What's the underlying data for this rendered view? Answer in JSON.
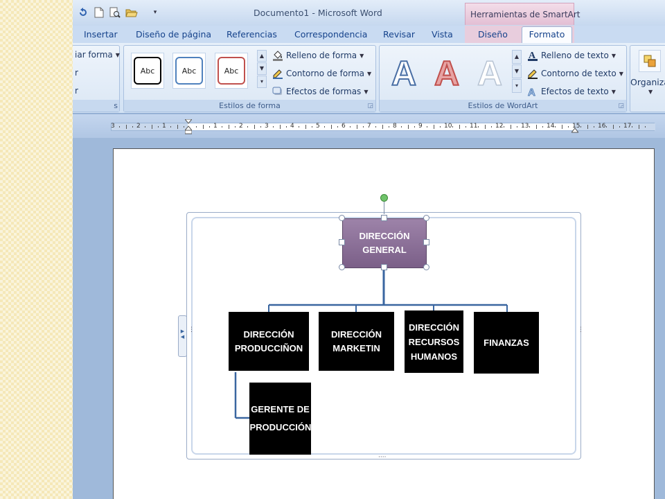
{
  "window": {
    "title": "Documento1 - Microsoft Word"
  },
  "contextual_tab_group": "Herramientas de SmartArt",
  "tabs": [
    "Insertar",
    "Diseño de página",
    "Referencias",
    "Correspondencia",
    "Revisar",
    "Vista",
    "Diseño",
    "Formato"
  ],
  "active_tab": "Formato",
  "ribbon": {
    "left_partial": [
      "iar forma",
      "r",
      "r"
    ],
    "shape_styles": {
      "swatches": [
        "Abc",
        "Abc",
        "Abc"
      ],
      "fill": "Relleno de forma",
      "outline": "Contorno de forma",
      "effects": "Efectos de formas",
      "label": "Estilos de forma"
    },
    "wordart_styles": {
      "swatches": [
        "A",
        "A",
        "A"
      ],
      "fill": "Relleno de texto",
      "outline": "Contorno de texto",
      "effects": "Efectos de texto",
      "label": "Estilos de WordArt"
    },
    "arrange": {
      "label": "Organiza"
    }
  },
  "ruler": {
    "labels": [
      "3",
      "2",
      "1",
      "1",
      "2",
      "3",
      "4",
      "5",
      "6",
      "7",
      "8",
      "9",
      "10",
      "11",
      "12",
      "13",
      "14",
      "15",
      "16",
      "17"
    ]
  },
  "org_chart": {
    "top": "DIRECCIÓN GENERAL",
    "children": [
      "DIRECCIÓN PRODUCCIÑON",
      "DIRECCIÓN MARKETIN",
      "DIRECCIÓN RECURSOS HUMANOS",
      "FINANZAS"
    ],
    "sub_child": "GERENTE DE PRODUCCIÓN"
  },
  "colors": {
    "accent_selected": "#7b5f88",
    "ribbon": "#d2e2f4",
    "node": "#000000",
    "connector": "#3a66a0"
  }
}
